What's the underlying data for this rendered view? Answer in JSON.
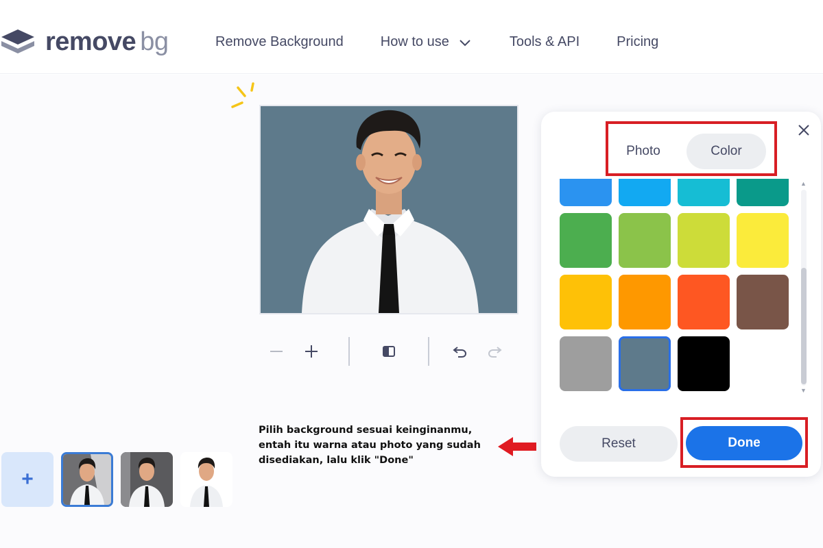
{
  "header": {
    "logo_remove": "remove",
    "logo_bg": "bg",
    "nav": [
      {
        "label": "Remove Background"
      },
      {
        "label": "How to use",
        "dropdown": true
      },
      {
        "label": "Tools & API"
      },
      {
        "label": "Pricing"
      }
    ]
  },
  "editor": {
    "toolbar": {
      "icons": [
        "zoom-out-icon",
        "zoom-in-icon",
        "compare-icon",
        "undo-icon",
        "redo-icon"
      ]
    },
    "thumbnails": {
      "add_label": "+",
      "count": 3,
      "selected_index": 0
    }
  },
  "annotation": {
    "text": "Pilih background sesuai keinginanmu,\nentah itu warna atau photo yang sudah\ndisediakan, lalu klik \"Done\""
  },
  "panel": {
    "tabs": [
      {
        "label": "Photo",
        "active": false
      },
      {
        "label": "Color",
        "active": true
      }
    ],
    "swatches": [
      "#2b93f0",
      "#12a9f2",
      "#16bdd4",
      "#0a9a8a",
      "#4cae4f",
      "#8bc34a",
      "#cddc39",
      "#fbeb3b",
      "#fec107",
      "#fe9800",
      "#fe5722",
      "#795548",
      "#9e9e9e",
      "#5e7a8b",
      "#000000"
    ],
    "selected_swatch": "#5e7a8b",
    "reset_label": "Reset",
    "done_label": "Done"
  },
  "colors": {
    "accent": "#1b73e8",
    "highlight_red": "#d81e24",
    "text": "#454964"
  }
}
